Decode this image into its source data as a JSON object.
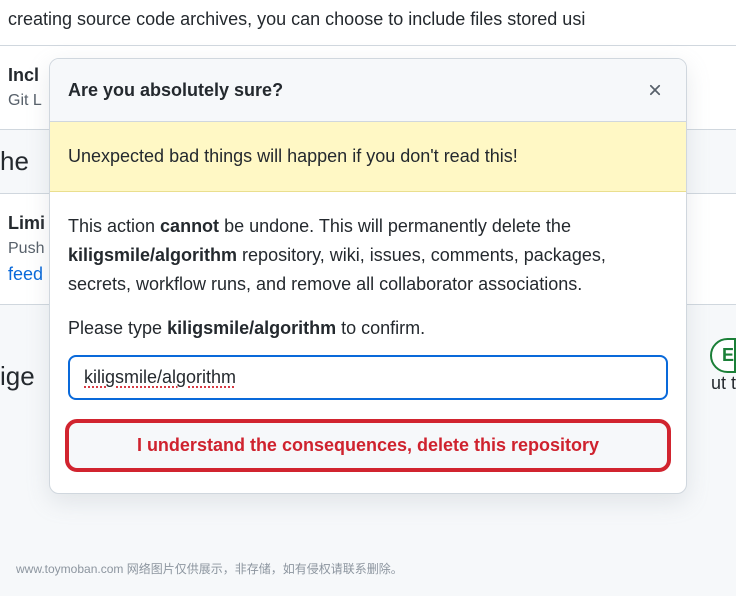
{
  "background": {
    "top_text": "creating source code archives, you can choose to include files stored usi",
    "include_label": "Incl",
    "include_sub": "Git L",
    "heading_frag_1": "he",
    "limit_label": "Limi",
    "limit_sub": "Push",
    "limit_link": "feed",
    "badge_frag": "E",
    "cutoff_frag": "ut t",
    "heading_frag_2": "ige",
    "attribution": "www.toymoban.com 网络图片仅供展示，非存储，如有侵权请联系删除。"
  },
  "modal": {
    "title": "Are you absolutely sure?",
    "warning": "Unexpected bad things will happen if you don't read this!",
    "body_pre": "This action ",
    "body_cannot": "cannot",
    "body_mid1": " be undone. This will permanently delete the ",
    "repo_name": "kiligsmile/algorithm",
    "body_mid2": " repository, wiki, issues, comments, packages, secrets, workflow runs, and remove all collaborator associations.",
    "confirm_pre": "Please type ",
    "confirm_repo": "kiligsmile/algorithm",
    "confirm_post": " to confirm.",
    "input_value": "kiligsmile/algorithm",
    "delete_button": "I understand the consequences, delete this repository"
  }
}
